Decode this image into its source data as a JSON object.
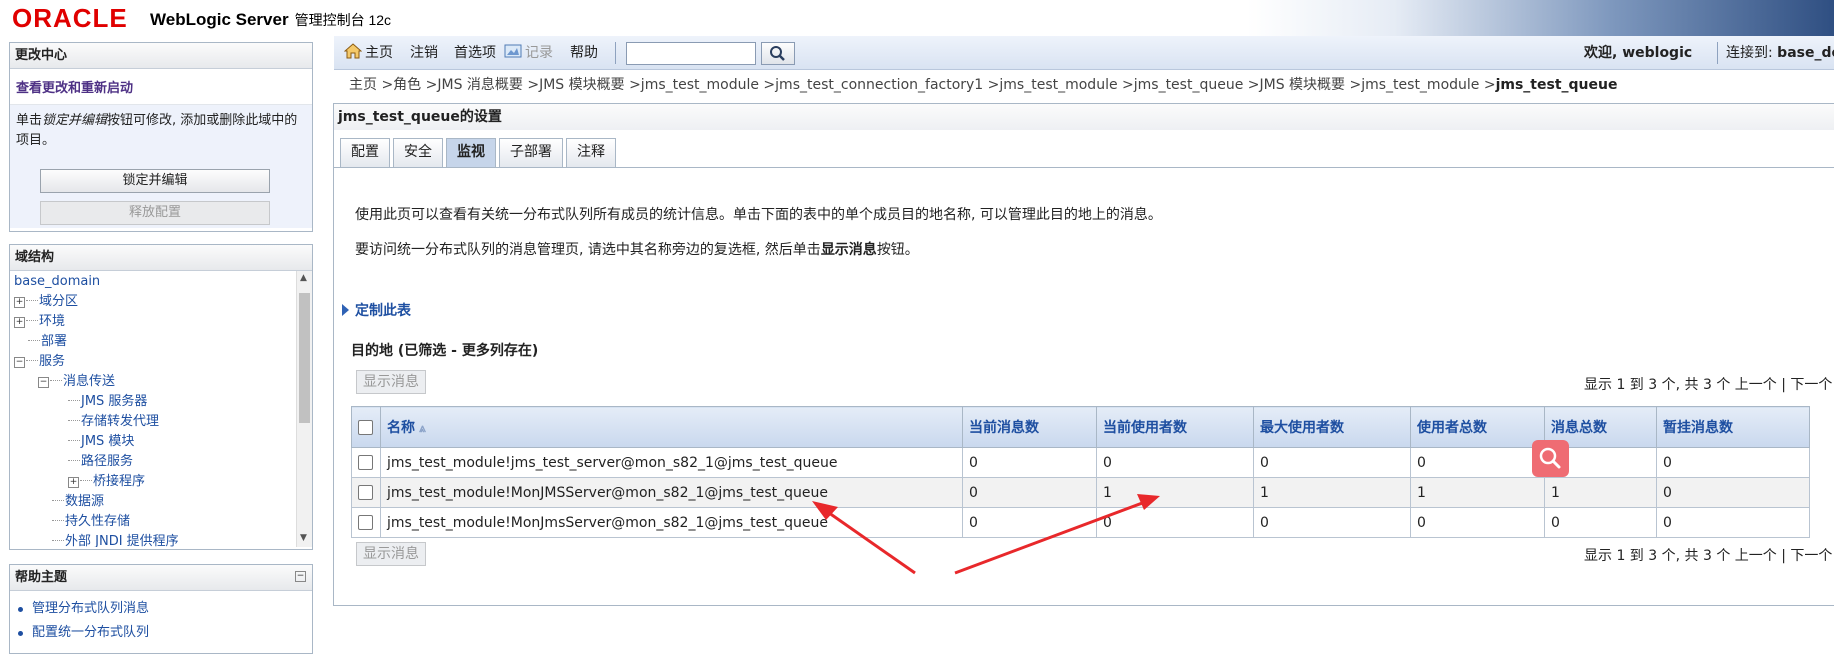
{
  "header": {
    "logo": "ORACLE",
    "product": "WebLogic Server",
    "product_sub": "管理控制台 12c"
  },
  "change_center": {
    "title": "更改中心",
    "link": "查看更改和重新启动",
    "desc_pre": "单击",
    "desc_em": "锁定并编辑",
    "desc_post": "按钮可修改, 添加或删除此域中的项目。",
    "lock_button": "锁定并编辑",
    "release_button": "释放配置"
  },
  "domain_structure": {
    "title": "域结构",
    "root": "base_domain",
    "items": [
      "域分区",
      "环境",
      "部署",
      "服务",
      "消息传送",
      "JMS 服务器",
      "存储转发代理",
      "JMS 模块",
      "路径服务",
      "桥接程序",
      "数据源",
      "持久性存储",
      "外部 JNDI 提供程序"
    ]
  },
  "help_topics": {
    "title": "帮助主题",
    "items": [
      "管理分布式队列消息",
      "配置统一分布式队列"
    ]
  },
  "toolbar": {
    "home": "主页",
    "logout": "注销",
    "preferences": "首选项",
    "record": "记录",
    "help": "帮助",
    "search_value": "",
    "welcome": "欢迎, weblogic",
    "connected_label": "连接到: ",
    "connected_value": "base_domain"
  },
  "breadcrumb": {
    "path": "主页 >角色 >JMS 消息概要 >JMS 模块概要 >jms_test_module >jms_test_connection_factory1 >jms_test_module >jms_test_queue >JMS 模块概要 >jms_test_module >",
    "current": "jms_test_queue"
  },
  "settings": {
    "title": "jms_test_queue的设置",
    "tabs": [
      "配置",
      "安全",
      "监视",
      "子部署",
      "注释"
    ],
    "active_tab": "监视",
    "intro1": "使用此页可以查看有关统一分布式队列所有成员的统计信息。单击下面的表中的单个成员目的地名称, 可以管理此目的地上的消息。",
    "intro2_pre": "要访问统一分布式队列的消息管理页, 请选中其名称旁边的复选框, 然后单击",
    "intro2_bold": "显示消息",
    "intro2_post": "按钮。",
    "customize": "定制此表",
    "table_caption": "目的地 (已筛选 - 更多列存在)",
    "show_messages": "显示消息",
    "pager": "显示 1 到 3 个, 共 3 个   上一个 | 下一个"
  },
  "table": {
    "columns": [
      "名称",
      "当前消息数",
      "当前使用者数",
      "最大使用者数",
      "使用者总数",
      "消息总数",
      "暂挂消息数"
    ],
    "rows": [
      [
        "jms_test_module!jms_test_server@mon_s82_1@jms_test_queue",
        "0",
        "0",
        "0",
        "0",
        "0",
        "0"
      ],
      [
        "jms_test_module!MonJMSServer@mon_s82_1@jms_test_queue",
        "0",
        "1",
        "1",
        "1",
        "1",
        "0"
      ],
      [
        "jms_test_module!MonJmsServer@mon_s82_1@jms_test_queue",
        "0",
        "0",
        "0",
        "0",
        "0",
        "0"
      ]
    ]
  },
  "colors": {
    "accent": "#1e4fa1",
    "oracle_red": "#e00000",
    "annotation": "#e8282b"
  }
}
